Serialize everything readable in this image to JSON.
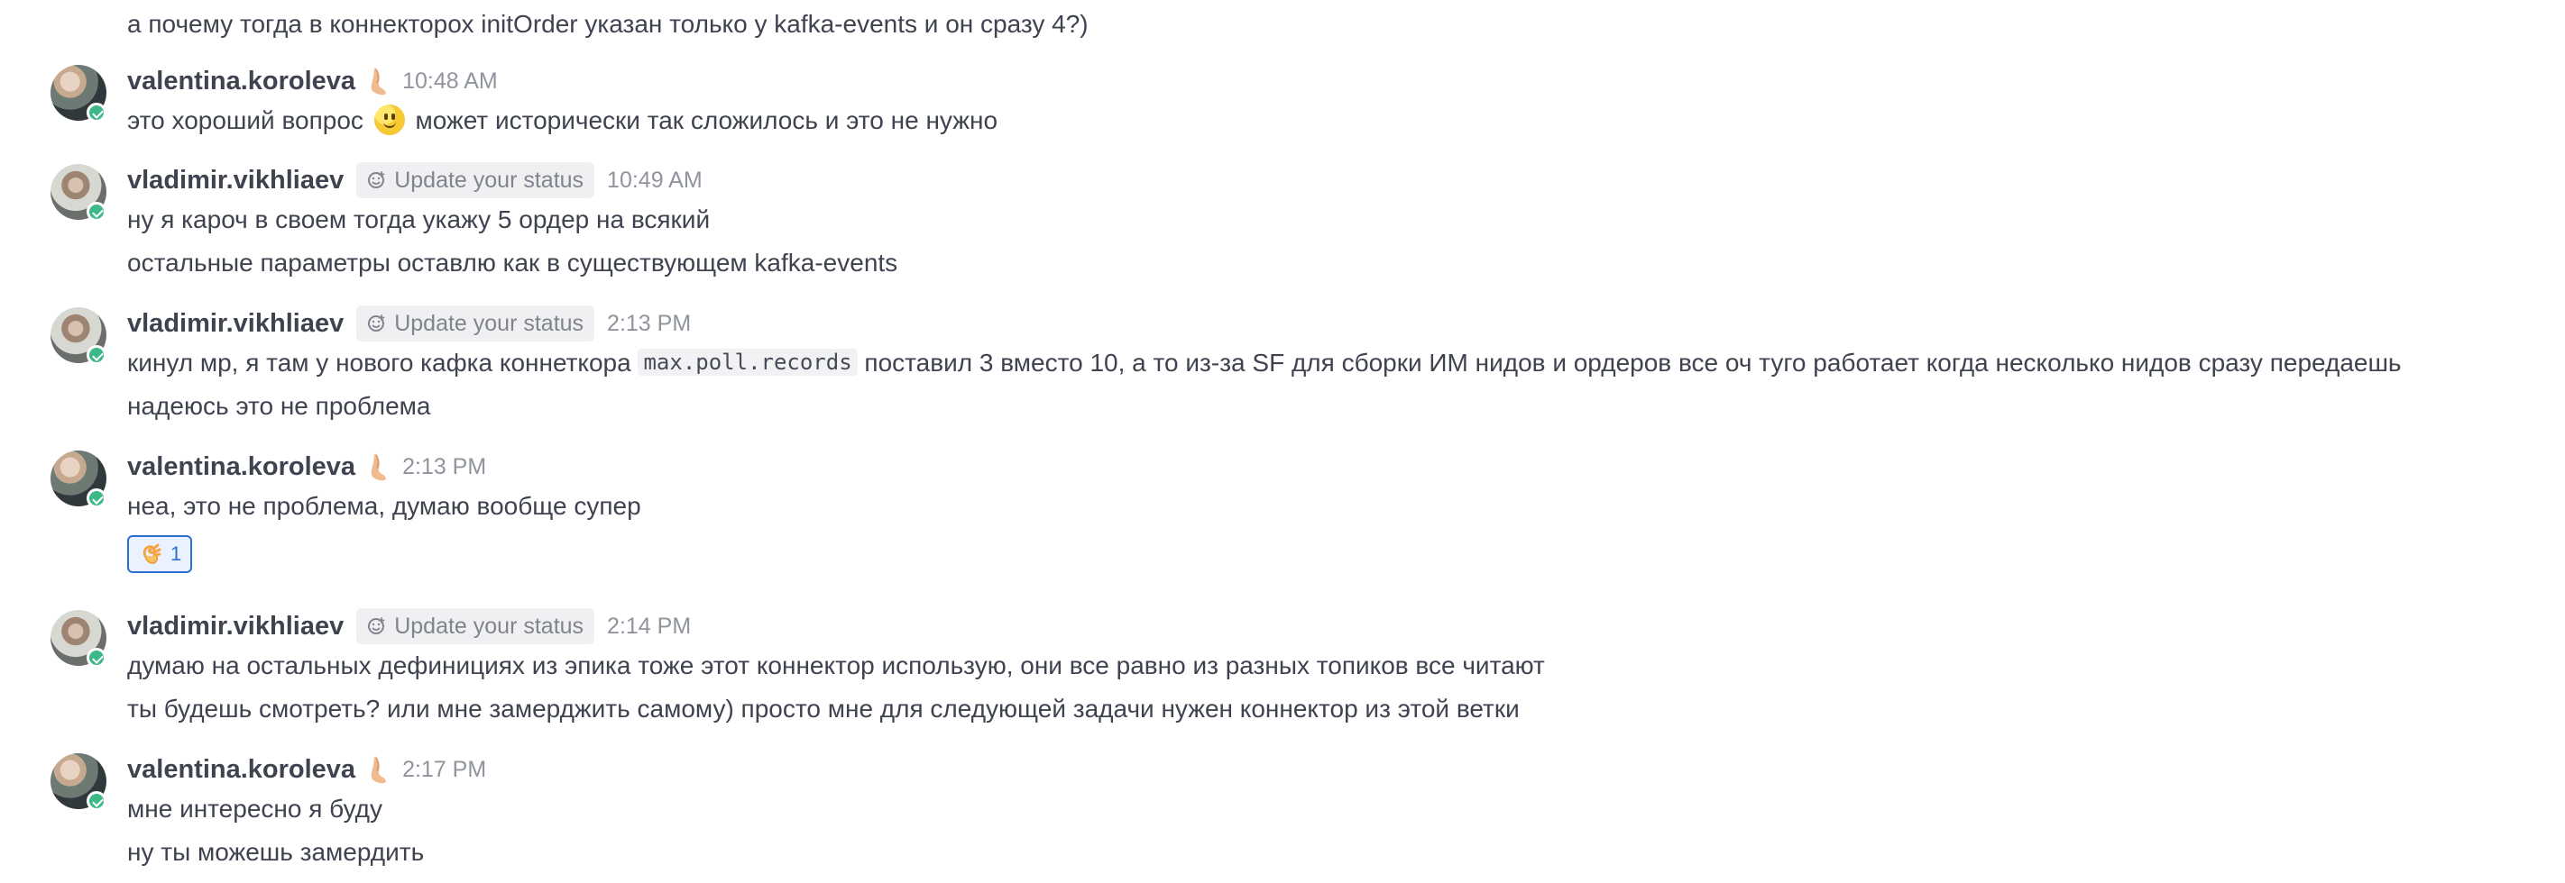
{
  "top_message": "а почему тогда в коннекторох initOrder указан только у kafka-events и он сразу 4?)",
  "posts": [
    {
      "username": "valentina.koroleva",
      "time": "10:48 AM",
      "status": "",
      "lines": [
        {
          "before_emoji": "это хороший вопрос ",
          "emoji": "slightly-smiling-face",
          "after_emoji": " может исторически так сложилось и это не нужно"
        }
      ]
    },
    {
      "username": "vladimir.vikhliaev",
      "time": "10:49 AM",
      "status": "Update your status",
      "lines": [
        " ну я кароч в своем тогда укажу 5 ордер на всякий",
        "остальные параметры оставлю как в существующем kafka-events"
      ]
    },
    {
      "username": "vladimir.vikhliaev",
      "time": "2:13 PM",
      "status": "Update your status",
      "lines": [
        {
          "before_code": "кинул мр, я там у нового кафка коннеткора ",
          "code": "max.poll.records",
          "after_code": " поставил 3 вместо 10, а то из-за SF для сборки ИМ нидов и ордеров все оч туго работает когда несколько нидов сразу передаешь"
        },
        "надеюсь это не проблема"
      ]
    },
    {
      "username": "valentina.koroleva",
      "time": "2:13 PM",
      "status": "",
      "lines": [
        "неа, это не проблема, думаю вообще супер"
      ],
      "reaction": {
        "emoji": "ok-hand",
        "count": "1"
      }
    },
    {
      "username": "vladimir.vikhliaev",
      "time": "2:14 PM",
      "status": "Update your status",
      "lines": [
        "думаю на остальных дефинициях из эпика тоже этот коннектор использую, они все равно из разных топиков все читают",
        "ты будешь смотреть? или мне замерджить самому) просто мне для следующей задачи нужен коннектор из этой ветки"
      ]
    },
    {
      "username": "valentina.koroleva",
      "time": "2:17 PM",
      "status": "",
      "lines": [
        "мне интересно я буду",
        "ну ты можешь замердить"
      ]
    }
  ],
  "icons": {
    "status_chip": "emoji-add-icon",
    "leg_status": "leg-icon",
    "avatar_status": "online-check-icon"
  },
  "colors": {
    "online": "#3db887",
    "link_blue": "#2d6fcc",
    "text": "#3f4350",
    "muted": "#8f949d",
    "chip_bg": "#f0f0f2"
  }
}
